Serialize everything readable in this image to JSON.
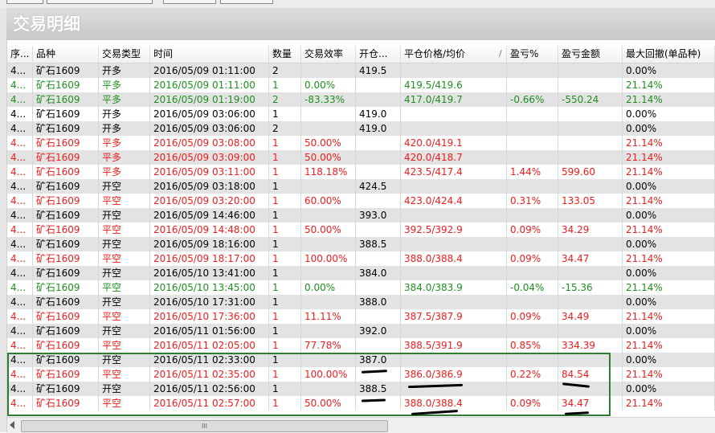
{
  "window": {
    "title": "交易明细"
  },
  "table": {
    "columns": [
      "序...",
      "品种",
      "交易类型",
      "时间",
      "数量",
      "交易效率",
      "开仓...",
      "平仓价格/均价",
      "盈亏%",
      "盈亏金额",
      "最大回撤(单品种)"
    ],
    "sort_indicator": "/",
    "rows": [
      {
        "seq": "4...",
        "sym": "矿石1609",
        "type": "开多",
        "time": "2016/05/09 01:11:00",
        "qty": "2",
        "eff": "",
        "open": "419.5",
        "close": "",
        "pnl_pct": "",
        "pnl_amt": "",
        "dd": "0.00%",
        "color": "black"
      },
      {
        "seq": "4...",
        "sym": "矿石1609",
        "type": "平多",
        "time": "2016/05/09 01:11:00",
        "qty": "1",
        "eff": "0.00%",
        "open": "",
        "close": "419.5/419.6",
        "pnl_pct": "",
        "pnl_amt": "",
        "dd": "21.14%",
        "color": "green"
      },
      {
        "seq": "4...",
        "sym": "矿石1609",
        "type": "平多",
        "time": "2016/05/09 01:19:00",
        "qty": "2",
        "eff": "-83.33%",
        "open": "",
        "close": "417.0/419.7",
        "pnl_pct": "-0.66%",
        "pnl_amt": "-550.24",
        "dd": "21.14%",
        "color": "green"
      },
      {
        "seq": "4...",
        "sym": "矿石1609",
        "type": "开多",
        "time": "2016/05/09 03:06:00",
        "qty": "1",
        "eff": "",
        "open": "419.0",
        "close": "",
        "pnl_pct": "",
        "pnl_amt": "",
        "dd": "0.00%",
        "color": "black"
      },
      {
        "seq": "4...",
        "sym": "矿石1609",
        "type": "开多",
        "time": "2016/05/09 03:06:00",
        "qty": "2",
        "eff": "",
        "open": "419.0",
        "close": "",
        "pnl_pct": "",
        "pnl_amt": "",
        "dd": "0.00%",
        "color": "black"
      },
      {
        "seq": "4...",
        "sym": "矿石1609",
        "type": "平多",
        "time": "2016/05/09 03:08:00",
        "qty": "1",
        "eff": "50.00%",
        "open": "",
        "close": "420.0/419.1",
        "pnl_pct": "",
        "pnl_amt": "",
        "dd": "21.14%",
        "color": "red"
      },
      {
        "seq": "4...",
        "sym": "矿石1609",
        "type": "平多",
        "time": "2016/05/09 03:09:00",
        "qty": "1",
        "eff": "50.00%",
        "open": "",
        "close": "420.0/418.7",
        "pnl_pct": "",
        "pnl_amt": "",
        "dd": "21.14%",
        "color": "red"
      },
      {
        "seq": "4...",
        "sym": "矿石1609",
        "type": "平多",
        "time": "2016/05/09 03:11:00",
        "qty": "1",
        "eff": "118.18%",
        "open": "",
        "close": "423.5/417.4",
        "pnl_pct": "1.44%",
        "pnl_amt": "599.60",
        "dd": "21.14%",
        "color": "red"
      },
      {
        "seq": "4...",
        "sym": "矿石1609",
        "type": "开空",
        "time": "2016/05/09 03:18:00",
        "qty": "1",
        "eff": "",
        "open": "424.5",
        "close": "",
        "pnl_pct": "",
        "pnl_amt": "",
        "dd": "0.00%",
        "color": "black"
      },
      {
        "seq": "4...",
        "sym": "矿石1609",
        "type": "平空",
        "time": "2016/05/09 03:20:00",
        "qty": "1",
        "eff": "60.00%",
        "open": "",
        "close": "423.0/424.4",
        "pnl_pct": "0.31%",
        "pnl_amt": "133.05",
        "dd": "21.14%",
        "color": "red"
      },
      {
        "seq": "4...",
        "sym": "矿石1609",
        "type": "开空",
        "time": "2016/05/09 14:46:00",
        "qty": "1",
        "eff": "",
        "open": "393.0",
        "close": "",
        "pnl_pct": "",
        "pnl_amt": "",
        "dd": "0.00%",
        "color": "black"
      },
      {
        "seq": "4...",
        "sym": "矿石1609",
        "type": "平空",
        "time": "2016/05/09 14:48:00",
        "qty": "1",
        "eff": "50.00%",
        "open": "",
        "close": "392.5/392.9",
        "pnl_pct": "0.09%",
        "pnl_amt": "34.29",
        "dd": "21.14%",
        "color": "red"
      },
      {
        "seq": "4...",
        "sym": "矿石1609",
        "type": "开空",
        "time": "2016/05/09 18:16:00",
        "qty": "1",
        "eff": "",
        "open": "388.5",
        "close": "",
        "pnl_pct": "",
        "pnl_amt": "",
        "dd": "0.00%",
        "color": "black"
      },
      {
        "seq": "4...",
        "sym": "矿石1609",
        "type": "平空",
        "time": "2016/05/09 18:17:00",
        "qty": "1",
        "eff": "100.00%",
        "open": "",
        "close": "388.0/388.4",
        "pnl_pct": "0.09%",
        "pnl_amt": "34.47",
        "dd": "21.14%",
        "color": "red"
      },
      {
        "seq": "4...",
        "sym": "矿石1609",
        "type": "开空",
        "time": "2016/05/10 13:41:00",
        "qty": "1",
        "eff": "",
        "open": "384.0",
        "close": "",
        "pnl_pct": "",
        "pnl_amt": "",
        "dd": "0.00%",
        "color": "black"
      },
      {
        "seq": "4...",
        "sym": "矿石1609",
        "type": "平空",
        "time": "2016/05/10 13:45:00",
        "qty": "1",
        "eff": "0.00%",
        "open": "",
        "close": "384.0/383.9",
        "pnl_pct": "-0.04%",
        "pnl_amt": "-15.36",
        "dd": "21.14%",
        "color": "green"
      },
      {
        "seq": "4...",
        "sym": "矿石1609",
        "type": "开空",
        "time": "2016/05/10 17:31:00",
        "qty": "1",
        "eff": "",
        "open": "388.0",
        "close": "",
        "pnl_pct": "",
        "pnl_amt": "",
        "dd": "0.00%",
        "color": "black"
      },
      {
        "seq": "4...",
        "sym": "矿石1609",
        "type": "平空",
        "time": "2016/05/10 17:36:00",
        "qty": "1",
        "eff": "11.11%",
        "open": "",
        "close": "387.5/387.9",
        "pnl_pct": "0.09%",
        "pnl_amt": "34.49",
        "dd": "21.14%",
        "color": "red"
      },
      {
        "seq": "4...",
        "sym": "矿石1609",
        "type": "开空",
        "time": "2016/05/11 01:56:00",
        "qty": "1",
        "eff": "",
        "open": "392.0",
        "close": "",
        "pnl_pct": "",
        "pnl_amt": "",
        "dd": "0.00%",
        "color": "black"
      },
      {
        "seq": "4...",
        "sym": "矿石1609",
        "type": "平空",
        "time": "2016/05/11 02:05:00",
        "qty": "1",
        "eff": "77.78%",
        "open": "",
        "close": "388.5/391.9",
        "pnl_pct": "0.85%",
        "pnl_amt": "334.39",
        "dd": "21.14%",
        "color": "red"
      },
      {
        "seq": "4...",
        "sym": "矿石1609",
        "type": "开空",
        "time": "2016/05/11 02:33:00",
        "qty": "1",
        "eff": "",
        "open": "387.0",
        "close": "",
        "pnl_pct": "",
        "pnl_amt": "",
        "dd": "0.00%",
        "color": "black"
      },
      {
        "seq": "4...",
        "sym": "矿石1609",
        "type": "平空",
        "time": "2016/05/11 02:35:00",
        "qty": "1",
        "eff": "100.00%",
        "open": "",
        "close": "386.0/386.9",
        "pnl_pct": "0.22%",
        "pnl_amt": "84.54",
        "dd": "21.14%",
        "color": "red"
      },
      {
        "seq": "4...",
        "sym": "矿石1609",
        "type": "开空",
        "time": "2016/05/11 02:56:00",
        "qty": "1",
        "eff": "",
        "open": "388.5",
        "close": "",
        "pnl_pct": "",
        "pnl_amt": "",
        "dd": "0.00%",
        "color": "black"
      },
      {
        "seq": "4...",
        "sym": "矿石1609",
        "type": "平空",
        "time": "2016/05/11 02:57:00",
        "qty": "1",
        "eff": "50.00%",
        "open": "",
        "close": "388.0/388.4",
        "pnl_pct": "0.09%",
        "pnl_amt": "34.47",
        "dd": "21.14%",
        "color": "red"
      }
    ]
  },
  "scrollbar": {
    "thumb_grip": "III"
  },
  "colors": {
    "profit_row": "#ee1c1c",
    "loss_row": "#1f8f1f",
    "open_row": "#000000",
    "highlight_box": "#2e7d32"
  }
}
